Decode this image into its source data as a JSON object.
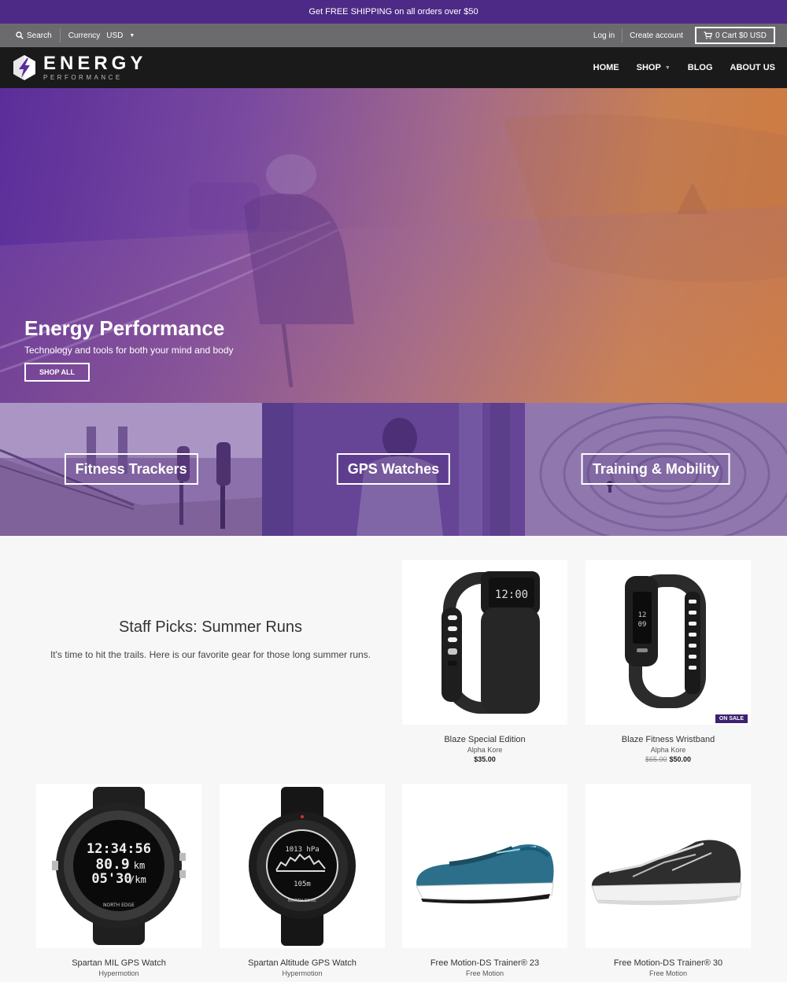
{
  "announcement": "Get FREE SHIPPING on all orders over $50",
  "utility": {
    "search_label": "Search",
    "currency_label": "Currency",
    "currency_value": "USD",
    "login": "Log in",
    "create_account": "Create account",
    "cart": "0 Cart $0 USD"
  },
  "brand": {
    "name": "ENERGY",
    "tagline": "PERFORMANCE"
  },
  "nav": [
    {
      "label": "HOME"
    },
    {
      "label": "SHOP"
    },
    {
      "label": "BLOG"
    },
    {
      "label": "ABOUT US"
    }
  ],
  "hero": {
    "title": "Energy Performance",
    "subtitle": "Technology and tools for both your mind and body",
    "button": "SHOP ALL"
  },
  "collections": [
    {
      "label": "Fitness Trackers"
    },
    {
      "label": "GPS Watches"
    },
    {
      "label": "Training & Mobility"
    }
  ],
  "staff_picks": {
    "title": "Staff Picks: Summer Runs",
    "description": "It's time to hit the trails. Here is our favorite gear for those long summer runs."
  },
  "products": [
    {
      "name": "Blaze Special Edition",
      "vendor": "Alpha Kore",
      "price": "$35.00",
      "compare_price": "",
      "badge": ""
    },
    {
      "name": "Blaze Fitness Wristband",
      "vendor": "Alpha Kore",
      "price": "$50.00",
      "compare_price": "$65.00",
      "badge": "ON SALE"
    },
    {
      "name": "Spartan MIL GPS Watch",
      "vendor": "Hypermotion",
      "watch_face": [
        "12:34:56",
        "80.9",
        "km",
        "05'30",
        "/km"
      ],
      "bezel": "NORTH EDGE"
    },
    {
      "name": "Spartan Altitude GPS Watch",
      "vendor": "Hypermotion",
      "watch_face": [
        "1013 hPa",
        "105m"
      ],
      "bezel": "NORTH EDGE"
    },
    {
      "name": "Free Motion-DS Trainer® 23",
      "vendor": "Free Motion"
    },
    {
      "name": "Free Motion-DS Trainer® 30",
      "vendor": "Free Motion"
    }
  ],
  "tracker_screen": "12:00",
  "colors": {
    "brand_purple": "#4d2a86",
    "header_black": "#1a1a1a",
    "util_gray": "#6b6b6e",
    "accent_orange": "#cf7a3c"
  }
}
